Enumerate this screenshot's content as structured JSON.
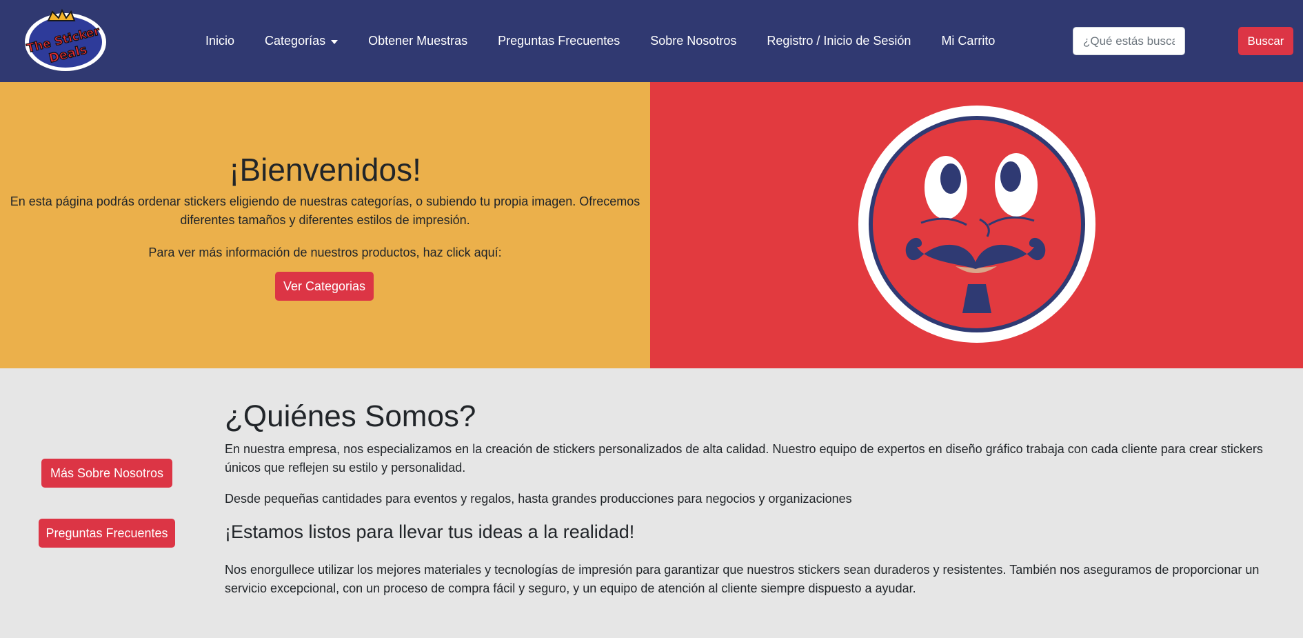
{
  "logo": {
    "text_line1": "The Sticker",
    "text_line2": "Deals"
  },
  "nav": {
    "items": [
      {
        "label": "Inicio"
      },
      {
        "label": "Categorías"
      },
      {
        "label": "Obtener Muestras"
      },
      {
        "label": "Preguntas Frecuentes"
      },
      {
        "label": "Sobre Nosotros"
      },
      {
        "label": "Registro / Inicio de Sesión"
      },
      {
        "label": "Mi Carrito"
      }
    ],
    "search": {
      "placeholder": "¿Qué estás buscando?",
      "value": "",
      "button_label": "Buscar"
    }
  },
  "hero": {
    "title": "¡Bienvenidos!",
    "text": "En esta página podrás ordenar stickers eligiendo de nuestras categorías, o subiendo tu propia imagen. Ofrecemos diferentes tamaños y diferentes estilos de impresión.",
    "info": "Para ver más información de nuestros productos, haz click aquí:",
    "button_label": "Ver Categorias"
  },
  "about": {
    "title": "¿Quiénes Somos?",
    "p1": "En nuestra empresa, nos especializamos en la creación de stickers personalizados de alta calidad. Nuestro equipo de expertos en diseño gráfico trabaja con cada cliente para crear stickers únicos que reflejen su estilo y personalidad.",
    "p2": "Desde pequeñas cantidades para eventos y regalos, hasta grandes producciones para negocios y organizaciones",
    "subtitle": "¡Estamos listos para llevar tus ideas a la realidad!",
    "p3": "Nos enorgullece utilizar los mejores materiales y tecnologías de impresión para garantizar que nuestros stickers sean duraderos y resistentes. También nos aseguramos de proporcionar un servicio excepcional, con un proceso de compra fácil y seguro, y un equipo de atención al cliente siempre dispuesto a ayudar.",
    "side_buttons": [
      {
        "label": "Más Sobre Nosotros"
      },
      {
        "label": "Preguntas Frecuentes"
      }
    ]
  },
  "colors": {
    "navbar": "#303971",
    "accent": "#dc3545",
    "hero_left": "#ebb04b",
    "hero_right": "#e23a3f",
    "page": "#e6e6e6"
  }
}
